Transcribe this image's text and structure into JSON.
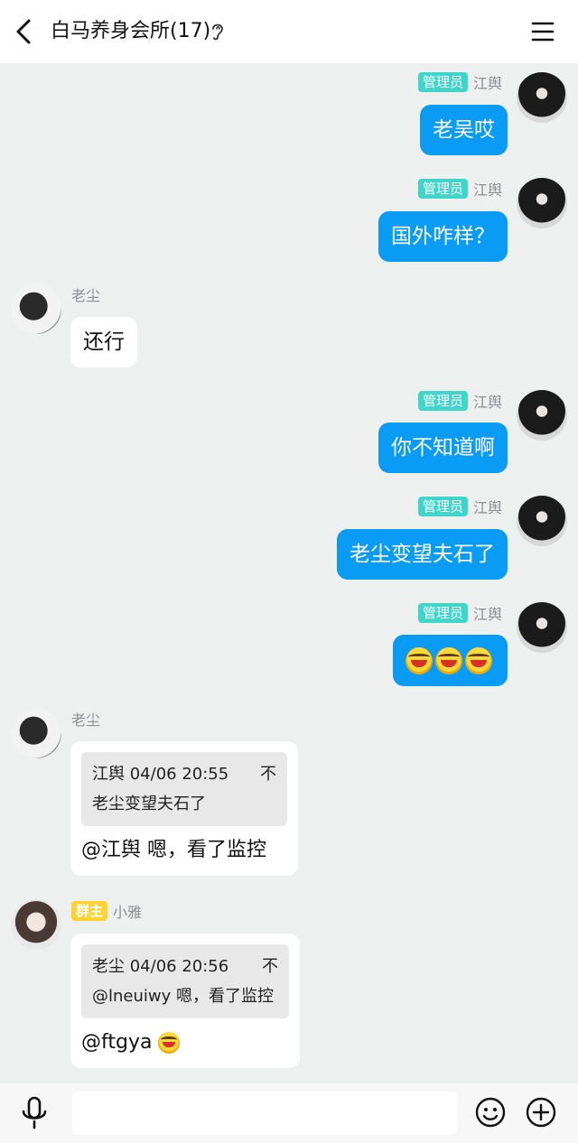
{
  "header": {
    "title": "白马养身会所(17)",
    "icons": {
      "back": "back-arrow-icon",
      "ear": "ear-icon",
      "menu": "hamburger-menu-icon"
    }
  },
  "badges": {
    "admin": "管理员",
    "owner": "群主"
  },
  "messages": [
    {
      "sender": "江舆",
      "role": "管理员",
      "side": "right",
      "text": "老吴哎"
    },
    {
      "sender": "江舆",
      "role": "管理员",
      "side": "right",
      "text": "国外咋样？"
    },
    {
      "sender": "老尘",
      "role": "",
      "side": "left",
      "text": "还行"
    },
    {
      "sender": "江舆",
      "role": "管理员",
      "side": "right",
      "text": "你不知道啊"
    },
    {
      "sender": "江舆",
      "role": "管理员",
      "side": "right",
      "text": "老尘变望夫石了"
    },
    {
      "sender": "江舆",
      "role": "管理员",
      "side": "right",
      "text": "",
      "emoji": "laughing-emoji x3"
    },
    {
      "sender": "老尘",
      "role": "",
      "side": "left",
      "quote": {
        "header": "江舆 04/06 20:55",
        "pin": "不",
        "text": "老尘变望夫石了"
      },
      "text": "@江舆 嗯，看了监控"
    },
    {
      "sender": "小雅",
      "role": "群主",
      "side": "left",
      "quote": {
        "header": "老尘 04/06 20:56",
        "pin": "不",
        "text": "@lneuiwy 嗯，看了监控"
      },
      "text": "@ftgya",
      "emoji": "laughing-emoji"
    }
  ],
  "footer": {
    "input_placeholder": "",
    "icons": {
      "mic": "microphone-icon",
      "emoji": "smiley-icon",
      "more": "plus-circle-icon"
    }
  },
  "colors": {
    "outgoing_bubble": "#0a9cf5",
    "admin_badge": "#3fd6c9",
    "owner_badge": "#ffd233",
    "chat_bg": "#edf0ee"
  }
}
